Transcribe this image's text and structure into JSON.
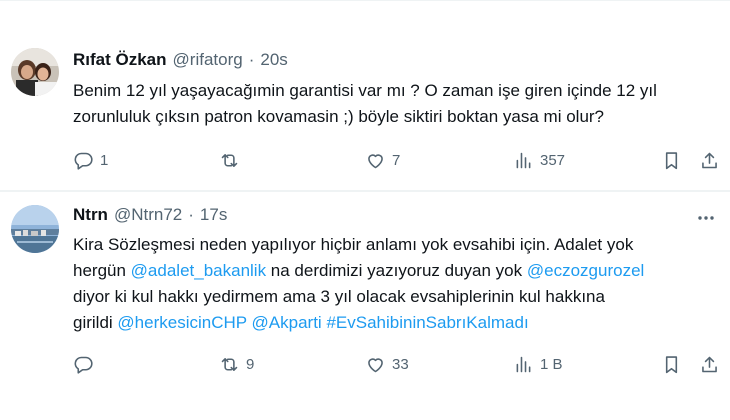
{
  "tweets": [
    {
      "name": "Rıfat Özkan",
      "handle": "@rifatorg",
      "time": "20s",
      "lines": [
        [
          {
            "t": "Benim 12 yıl yaşayacağımin garantisi var mı ? O zaman işe giren içinde 12 yıl",
            "m": false
          }
        ],
        [
          {
            "t": "zorunluluk çıksın patron kovamasin ;) böyle siktiri boktan yasa mi olur?",
            "m": false
          }
        ]
      ],
      "replies": "1",
      "retweets": "",
      "likes": "7",
      "views": "357"
    },
    {
      "name": "Ntrn",
      "handle": "@Ntrn72",
      "time": "17s",
      "lines": [
        [
          {
            "t": "Kira Sözleşmesi neden yapılıyor hiçbir anlamı yok evsahibi için.  Adalet yok",
            "m": false
          }
        ],
        [
          {
            "t": "hergün ",
            "m": false
          },
          {
            "t": "@adalet_bakanlik",
            "m": true
          },
          {
            "t": " na derdimizi yazıyoruz duyan yok ",
            "m": false
          },
          {
            "t": "@eczozgurozel",
            "m": true
          }
        ],
        [
          {
            "t": "diyor ki kul hakkı yedirmem ama 3 yıl olacak evsahiplerinin kul hakkına",
            "m": false
          }
        ],
        [
          {
            "t": "girildi ",
            "m": false
          },
          {
            "t": "@herkesicinCHP",
            "m": true
          },
          {
            "t": " ",
            "m": false
          },
          {
            "t": "@Akparti",
            "m": true
          },
          {
            "t": " ",
            "m": false
          },
          {
            "t": "#EvSahibininSabrıKalmadı",
            "m": true
          }
        ]
      ],
      "replies": "",
      "retweets": "9",
      "likes": "33",
      "views": "1 B"
    }
  ],
  "icons": {
    "reply": "reply-icon",
    "retweet": "retweet-icon",
    "like": "like-icon",
    "views": "views-icon",
    "bookmark": "bookmark-icon",
    "share": "share-icon",
    "more": "more-icon"
  },
  "colors": {
    "text": "#0f1419",
    "secondary": "#536471",
    "link": "#1d9bf0",
    "divider": "#eff3f4"
  }
}
